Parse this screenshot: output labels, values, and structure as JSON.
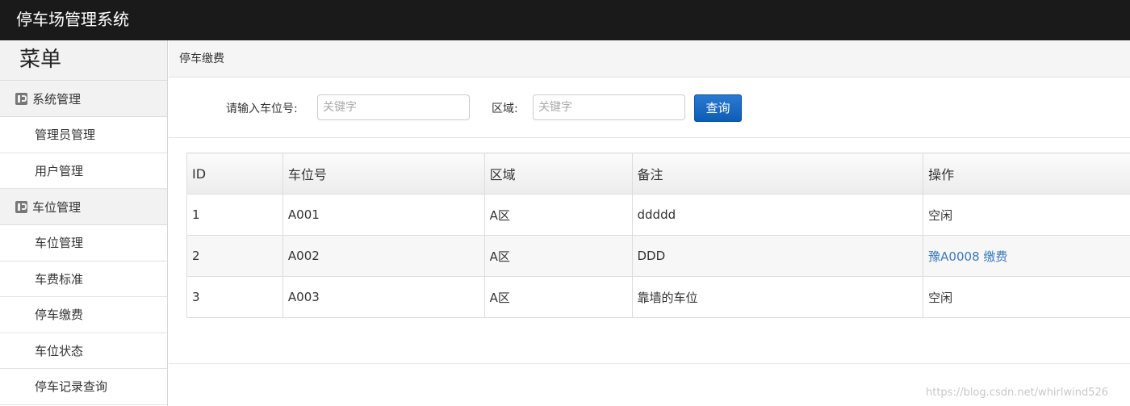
{
  "app": {
    "title": "停车场管理系统"
  },
  "sidebar": {
    "title": "菜单",
    "groups": [
      {
        "label": "系统管理",
        "items": [
          "管理员管理",
          "用户管理"
        ]
      },
      {
        "label": "车位管理",
        "items": [
          "车位管理",
          "车费标准",
          "停车缴费",
          "车位状态",
          "停车记录查询"
        ]
      }
    ]
  },
  "breadcrumb": "停车缴费",
  "search": {
    "spot_label": "请输入车位号:",
    "spot_placeholder": "关键字",
    "area_label": "区域:",
    "area_placeholder": "关键字",
    "query_button": "查询"
  },
  "table": {
    "headers": [
      "ID",
      "车位号",
      "区域",
      "备注",
      "操作"
    ],
    "rows": [
      {
        "id": "1",
        "spot": "A001",
        "area": "A区",
        "note": "ddddd",
        "op": "空闲",
        "op_link": false
      },
      {
        "id": "2",
        "spot": "A002",
        "area": "A区",
        "note": "DDD",
        "op": "豫A0008 缴费",
        "op_link": true
      },
      {
        "id": "3",
        "spot": "A003",
        "area": "A区",
        "note": "靠墙的车位",
        "op": "空闲",
        "op_link": false
      }
    ]
  },
  "colors": {
    "topbar": "#1a1a1a",
    "button": "#1565c0",
    "link": "#3a7ac0"
  },
  "watermark": "https://blog.csdn.net/whirlwind526"
}
